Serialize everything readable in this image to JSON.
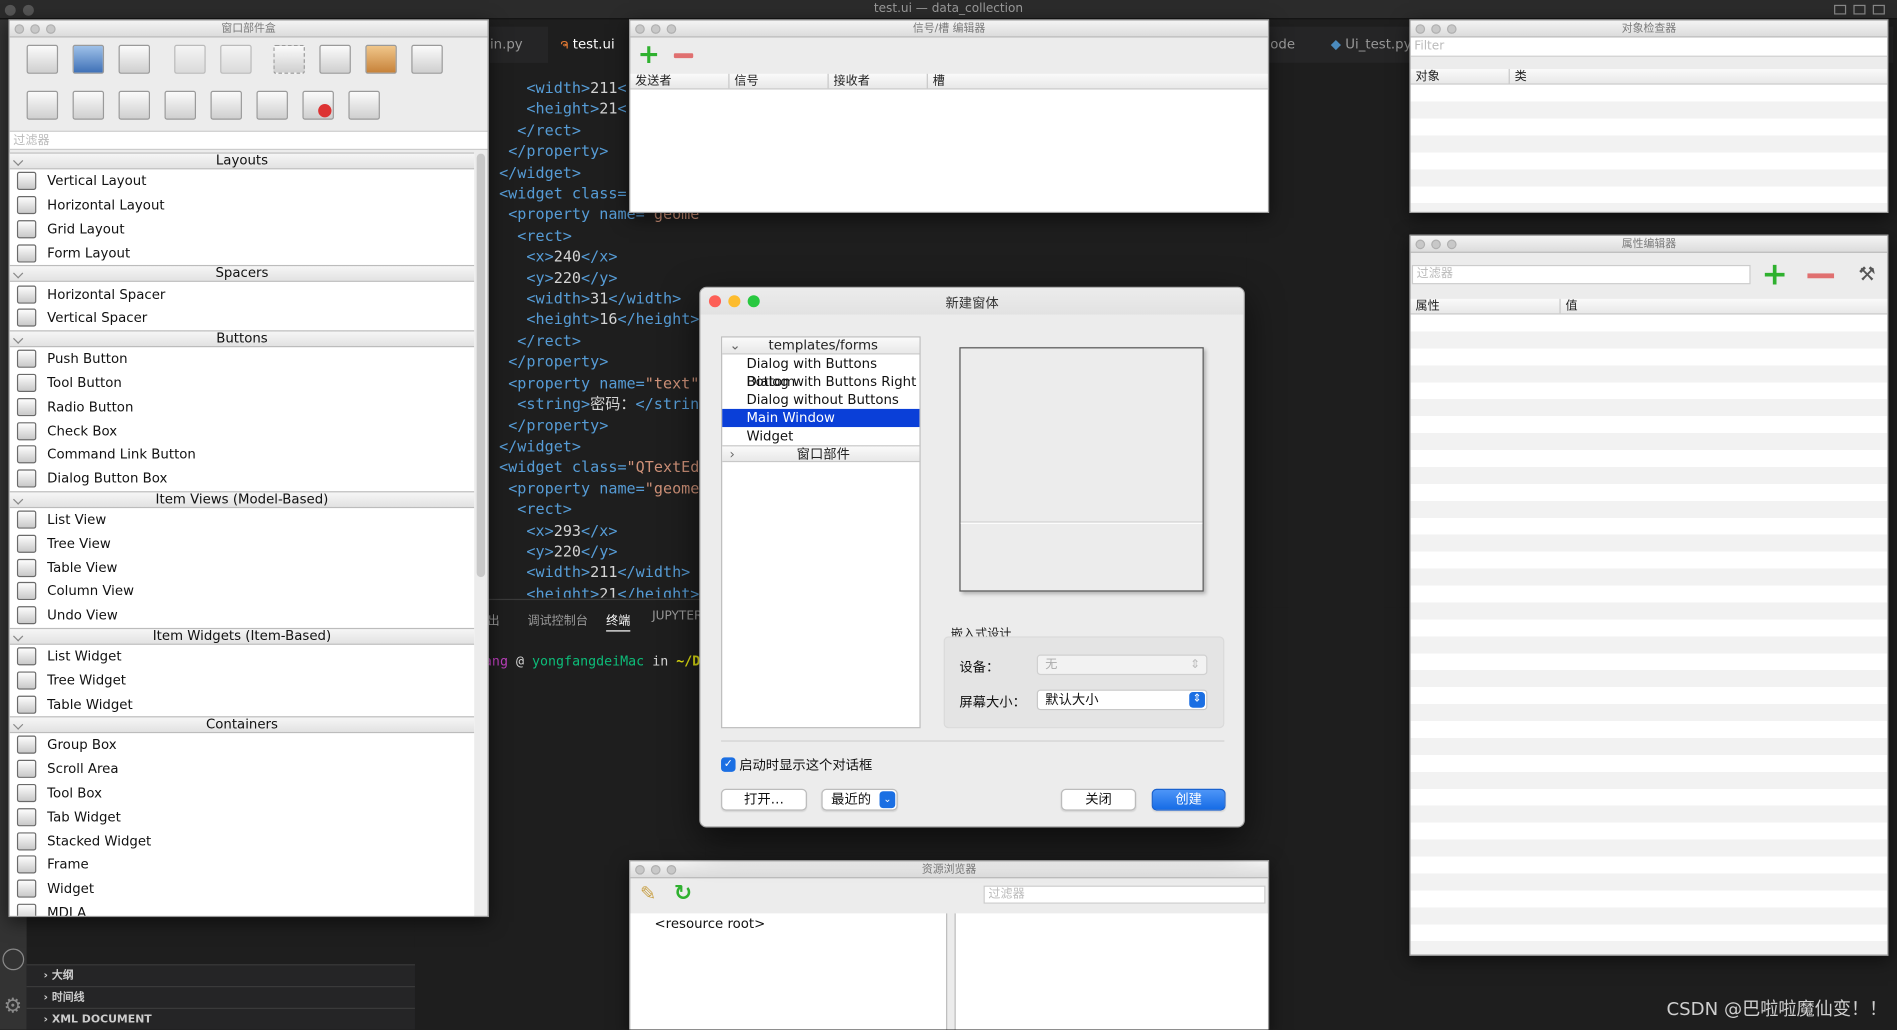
{
  "app_title": "test.ui — data_collection",
  "editor": {
    "tabs": [
      "in.py",
      "test.ui",
      "ode",
      "Ui_test.py"
    ],
    "lines": [
      [
        "    ",
        "<width>",
        "211",
        "<"
      ],
      [
        "    ",
        "<height>",
        "21",
        "<"
      ],
      [
        "   ",
        "</rect>",
        "",
        ""
      ],
      [
        "  ",
        "</property>",
        "",
        ""
      ],
      [
        " ",
        "</widget>",
        "",
        ""
      ],
      [
        " ",
        "<widget class=",
        "",
        ""
      ],
      [
        "  ",
        "<property name=\"geometry\">",
        "",
        ""
      ],
      [
        "   ",
        "<rect>",
        "",
        ""
      ],
      [
        "    ",
        "<x>",
        "240",
        "</x>"
      ],
      [
        "    ",
        "<y>",
        "220",
        "</y>"
      ],
      [
        "    ",
        "<width>",
        "31",
        "</width>"
      ],
      [
        "    ",
        "<height>",
        "16",
        "</height>"
      ],
      [
        "   ",
        "</rect>",
        "",
        ""
      ],
      [
        "  ",
        "</property>",
        "",
        ""
      ],
      [
        "  ",
        "<property name=\"text\"",
        "",
        ""
      ],
      [
        "   ",
        "<string>",
        "密码：",
        "</strin"
      ],
      [
        "  ",
        "</property>",
        "",
        ""
      ],
      [
        " ",
        "</widget>",
        "",
        ""
      ],
      [
        " ",
        "<widget class=\"QTextEd",
        "",
        ""
      ],
      [
        "  ",
        "<property name=\"geome",
        "",
        ""
      ],
      [
        "   ",
        "<rect>",
        "",
        ""
      ],
      [
        "    ",
        "<x>",
        "293",
        "</x>"
      ],
      [
        "    ",
        "<y>",
        "220",
        "</y>"
      ],
      [
        "    ",
        "<width>",
        "211",
        "</width>"
      ],
      [
        "    ",
        "<height>",
        "21",
        "</height>"
      ]
    ],
    "panel_tabs": [
      "出",
      "调试控制台",
      "终端",
      "JUPYTER"
    ],
    "terminal_line": {
      "user": "ang",
      "at": " @ ",
      "host": "yongfangdeiMac",
      "in": " in ",
      "path": "~/Docum"
    },
    "outline": [
      "大纲",
      "时间线",
      "XML DOCUMENT"
    ]
  },
  "widget_box": {
    "title": "窗口部件盒",
    "filter_placeholder": "过滤器",
    "categories": [
      {
        "name": "Layouts",
        "items": [
          "Vertical Layout",
          "Horizontal Layout",
          "Grid Layout",
          "Form Layout"
        ]
      },
      {
        "name": "Spacers",
        "items": [
          "Horizontal Spacer",
          "Vertical Spacer"
        ]
      },
      {
        "name": "Buttons",
        "items": [
          "Push Button",
          "Tool Button",
          "Radio Button",
          "Check Box",
          "Command Link Button",
          "Dialog Button Box"
        ]
      },
      {
        "name": "Item Views (Model-Based)",
        "items": [
          "List View",
          "Tree View",
          "Table View",
          "Column View",
          "Undo View"
        ]
      },
      {
        "name": "Item Widgets (Item-Based)",
        "items": [
          "List Widget",
          "Tree Widget",
          "Table Widget"
        ]
      },
      {
        "name": "Containers",
        "items": [
          "Group Box",
          "Scroll Area",
          "Tool Box",
          "Tab Widget",
          "Stacked Widget",
          "Frame",
          "Widget",
          "MDI A"
        ]
      }
    ]
  },
  "signal_editor": {
    "title": "信号/槽 编辑器",
    "columns": [
      "发送者",
      "信号",
      "接收者",
      "槽"
    ]
  },
  "object_inspector": {
    "title": "对象检查器",
    "filter_placeholder": "Filter",
    "columns": [
      "对象",
      "类"
    ]
  },
  "property_editor": {
    "title": "属性编辑器",
    "filter_placeholder": "过滤器",
    "columns": [
      "属性",
      "值"
    ]
  },
  "resource_browser": {
    "title": "资源浏览器",
    "filter_placeholder": "过滤器",
    "root": "<resource root>"
  },
  "new_form_dialog": {
    "title": "新建窗体",
    "tree_header": "templates/forms",
    "templates": [
      "Dialog with Buttons Bottom",
      "Dialog with Buttons Right",
      "Dialog without Buttons",
      "Main Window",
      "Widget"
    ],
    "selected_template": "Main Window",
    "widgets_group": "窗口部件",
    "embedded_title": "嵌入式设计",
    "device_label": "设备：",
    "device_value": "无",
    "screen_label": "屏幕大小：",
    "screen_value": "默认大小",
    "show_on_startup_label": "启动时显示这个对话框",
    "show_on_startup_checked": true,
    "open_button": "打开…",
    "recent_button": "最近的",
    "close_button": "关闭",
    "create_button": "创建"
  },
  "watermark": "CSDN @巴啦啦魔仙变！！",
  "colors": {
    "accent": "#0a5bd6",
    "selection": "#0a3fd8",
    "editor_bg": "#1e1e1e",
    "keyword": "#569cd6",
    "string": "#ce9178"
  }
}
